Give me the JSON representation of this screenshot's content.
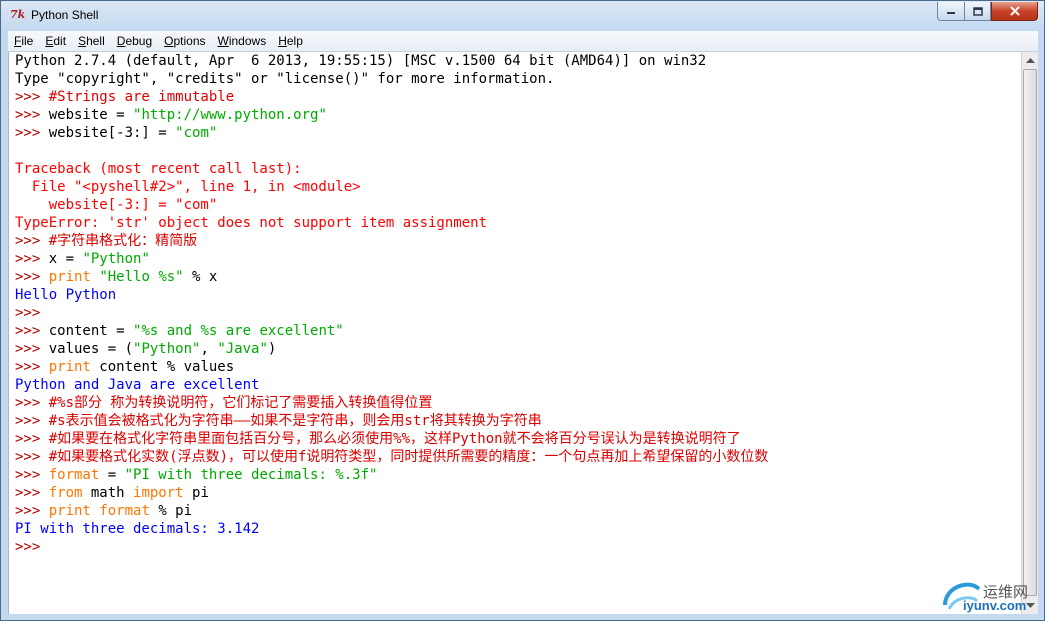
{
  "window": {
    "title": "Python Shell",
    "app_icon": "7k"
  },
  "menu": [
    {
      "label": "File",
      "accel": "F",
      "rest": "ile"
    },
    {
      "label": "Edit",
      "accel": "E",
      "rest": "dit"
    },
    {
      "label": "Shell",
      "accel": "S",
      "rest": "hell"
    },
    {
      "label": "Debug",
      "accel": "D",
      "rest": "ebug"
    },
    {
      "label": "Options",
      "accel": "O",
      "rest": "ptions"
    },
    {
      "label": "Windows",
      "accel": "W",
      "rest": "indows"
    },
    {
      "label": "Help",
      "accel": "H",
      "rest": "elp"
    }
  ],
  "colors": {
    "prompt": "#b00000",
    "comment": "#dd0000",
    "string": "#00aa00",
    "keyword": "#ff7700",
    "output": "#0000ff",
    "error": "#ff0000"
  },
  "shell_lines": [
    [
      [
        "k",
        "Python 2.7.4 (default, Apr  6 2013, 19:55:15) [MSC v.1500 64 bit (AMD64)] on win32"
      ]
    ],
    [
      [
        "k",
        "Type \"copyright\", \"credits\" or \"license()\" for more information."
      ]
    ],
    [
      [
        "p",
        ">>> "
      ],
      [
        "c",
        "#Strings are immutable"
      ]
    ],
    [
      [
        "p",
        ">>> "
      ],
      [
        "k",
        "website = "
      ],
      [
        "s",
        "\"http://www.python.org\""
      ]
    ],
    [
      [
        "p",
        ">>> "
      ],
      [
        "k",
        "website[-3:] = "
      ],
      [
        "s",
        "\"com\""
      ]
    ],
    [],
    [
      [
        "e",
        "Traceback (most recent call last):"
      ]
    ],
    [
      [
        "e",
        "  File \"<pyshell#2>\", line 1, in <module>"
      ]
    ],
    [
      [
        "e",
        "    website[-3:] = \"com\""
      ]
    ],
    [
      [
        "e",
        "TypeError: 'str' object does not support item assignment"
      ]
    ],
    [
      [
        "p",
        ">>> "
      ],
      [
        "c",
        "#字符串格式化：精简版"
      ]
    ],
    [
      [
        "p",
        ">>> "
      ],
      [
        "k",
        "x = "
      ],
      [
        "s",
        "\"Python\""
      ]
    ],
    [
      [
        "p",
        ">>> "
      ],
      [
        "kw",
        "print"
      ],
      [
        "k",
        " "
      ],
      [
        "s",
        "\"Hello %s\""
      ],
      [
        "k",
        " % x"
      ]
    ],
    [
      [
        "o",
        "Hello Python"
      ]
    ],
    [
      [
        "p",
        ">>> "
      ]
    ],
    [
      [
        "p",
        ">>> "
      ],
      [
        "k",
        "content = "
      ],
      [
        "s",
        "\"%s and %s are excellent\""
      ]
    ],
    [
      [
        "p",
        ">>> "
      ],
      [
        "k",
        "values = ("
      ],
      [
        "s",
        "\"Python\""
      ],
      [
        "k",
        ", "
      ],
      [
        "s",
        "\"Java\""
      ],
      [
        "k",
        ")"
      ]
    ],
    [
      [
        "p",
        ">>> "
      ],
      [
        "kw",
        "print"
      ],
      [
        "k",
        " content % values"
      ]
    ],
    [
      [
        "o",
        "Python and Java are excellent"
      ]
    ],
    [
      [
        "p",
        ">>> "
      ],
      [
        "c",
        "#%s部分 称为转换说明符，它们标记了需要插入转换值得位置"
      ]
    ],
    [
      [
        "p",
        ">>> "
      ],
      [
        "c",
        "#s表示值会被格式化为字符串——如果不是字符串，则会用str将其转换为字符串"
      ]
    ],
    [
      [
        "p",
        ">>> "
      ],
      [
        "c",
        "#如果要在格式化字符串里面包括百分号，那么必须使用%%，这样Python就不会将百分号误认为是转换说明符了"
      ]
    ],
    [
      [
        "p",
        ">>> "
      ],
      [
        "c",
        "#如果要格式化实数(浮点数)，可以使用f说明符类型，同时提供所需要的精度：一个句点再加上希望保留的小数位数"
      ]
    ],
    [
      [
        "p",
        ">>> "
      ],
      [
        "kw",
        "format"
      ],
      [
        "k",
        " = "
      ],
      [
        "s",
        "\"PI with three decimals: %.3f\""
      ]
    ],
    [
      [
        "p",
        ">>> "
      ],
      [
        "kw",
        "from"
      ],
      [
        "k",
        " math "
      ],
      [
        "kw",
        "import"
      ],
      [
        "k",
        " pi"
      ]
    ],
    [
      [
        "p",
        ">>> "
      ],
      [
        "kw",
        "print"
      ],
      [
        "k",
        " "
      ],
      [
        "kw",
        "format"
      ],
      [
        "k",
        " % pi"
      ]
    ],
    [
      [
        "o",
        "PI with three decimals: 3.142"
      ]
    ],
    [
      [
        "p",
        ">>> "
      ]
    ]
  ],
  "watermark": {
    "text": "运维网",
    "sub": "iyunv.com"
  }
}
